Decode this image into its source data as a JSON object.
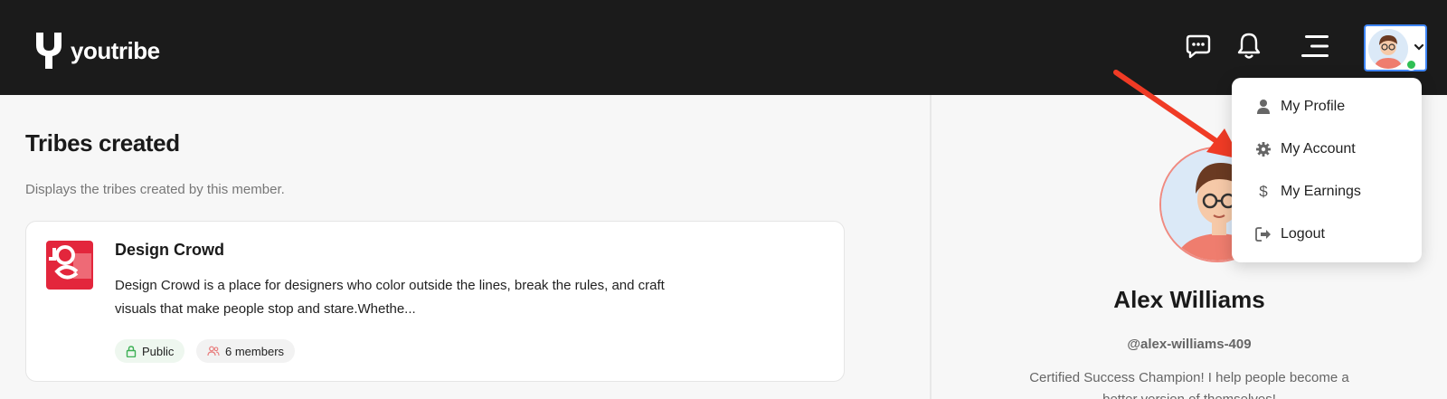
{
  "brand": {
    "name": "youtribe"
  },
  "header": {
    "icons": [
      "chat-icon",
      "bell-icon",
      "menu-icon"
    ],
    "avatar_status": "online"
  },
  "tribes": {
    "title": "Tribes created",
    "subtitle": "Displays the tribes created by this member.",
    "cards": [
      {
        "name": "Design Crowd",
        "description": "Design Crowd is a place for designers who color outside the lines, break the rules, and craft visuals that make people stop and stare.Whethe...",
        "visibility": "Public",
        "members": "6 members"
      }
    ]
  },
  "profile": {
    "name": "Alex Williams",
    "handle": "@alex-williams-409",
    "bio": "Certified Success Champion! I help people become a better version of themselves!"
  },
  "account_menu": {
    "items": [
      {
        "label": "My Profile",
        "icon": "user-icon"
      },
      {
        "label": "My Account",
        "icon": "gear-icon"
      },
      {
        "label": "My Earnings",
        "icon": "dollar-icon"
      },
      {
        "label": "Logout",
        "icon": "logout-icon"
      }
    ]
  },
  "colors": {
    "topbar": "#1b1b1b",
    "accent_border": "#3f86f7",
    "online": "#2fbf55",
    "tribe_logo": "#e3263c",
    "annotation_arrow": "#f03b25"
  }
}
